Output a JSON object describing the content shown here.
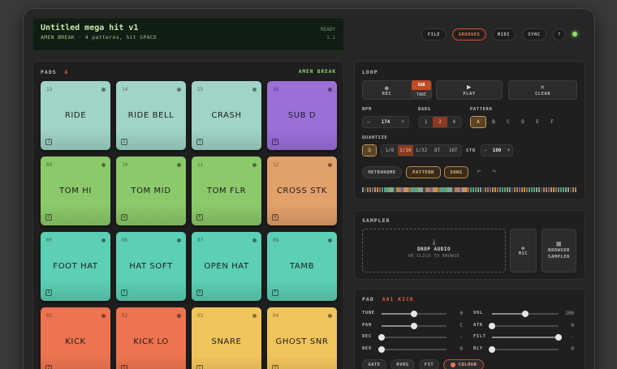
{
  "lcd": {
    "title": "Untitled mega hit v1",
    "subtitle": "AMEN BREAK · 4 patterns, hit SPACE",
    "status": "READY",
    "version": "1.1"
  },
  "topbar": {
    "file": "FILE",
    "grooves": "GROOVES",
    "midi": "MIDI",
    "sync": "SYNC",
    "help": "?"
  },
  "pads": {
    "label": "PADS",
    "bank": "A",
    "kit": "AMEN BREAK",
    "items": [
      {
        "num": "13",
        "name": "RIDE",
        "color": "#9fd4c6",
        "key": "1"
      },
      {
        "num": "14",
        "name": "RIDE BELL",
        "color": "#9fd4c6",
        "key": "2"
      },
      {
        "num": "15",
        "name": "CRASH",
        "color": "#9fd4c6",
        "key": "3"
      },
      {
        "num": "16",
        "name": "SUB D",
        "color": "#9a6fd8",
        "key": "4"
      },
      {
        "num": "09",
        "name": "TOM HI",
        "color": "#8cc96a",
        "key": "Q"
      },
      {
        "num": "10",
        "name": "TOM MID",
        "color": "#8cc96a",
        "key": "W"
      },
      {
        "num": "11",
        "name": "TOM FLR",
        "color": "#8cc96a",
        "key": "E"
      },
      {
        "num": "12",
        "name": "CROSS STK",
        "color": "#e2a06a",
        "key": "R"
      },
      {
        "num": "05",
        "name": "FOOT HAT",
        "color": "#5ccfb4",
        "key": "A"
      },
      {
        "num": "06",
        "name": "HAT SOFT",
        "color": "#5ccfb4",
        "key": "S"
      },
      {
        "num": "07",
        "name": "OPEN HAT",
        "color": "#5ccfb4",
        "key": "D"
      },
      {
        "num": "08",
        "name": "TAMB",
        "color": "#5ccfb4",
        "key": "F"
      },
      {
        "num": "01",
        "name": "KICK",
        "color": "#ec7450",
        "key": "Z"
      },
      {
        "num": "02",
        "name": "KICK LO",
        "color": "#ec7450",
        "key": "X"
      },
      {
        "num": "03",
        "name": "SNARE",
        "color": "#f0c45c",
        "key": "C"
      },
      {
        "num": "04",
        "name": "GHOST SNR",
        "color": "#f0c45c",
        "key": "V"
      }
    ]
  },
  "loop": {
    "label": "LOOP",
    "rec": "REC",
    "sub": "SUB",
    "take": "TAKE",
    "play": "PLAY",
    "clear": "CLEAR",
    "bpm_label": "BPM",
    "bpm": "174",
    "minus": "−",
    "plus": "+",
    "bars_label": "BARS",
    "bars": [
      "1",
      "2",
      "4"
    ],
    "pattern_label": "PATTERN",
    "patterns": [
      "A",
      "B",
      "C",
      "D",
      "E",
      "F"
    ],
    "quantize_label": "QUANTIZE",
    "q": "Q",
    "quant": [
      "1/8",
      "1/16",
      "1/32",
      "8T",
      "16T"
    ],
    "str_label": "STR",
    "str": "100",
    "metronome": "METRONOME",
    "pattern_btn": "PATTERN",
    "song_btn": "SONG",
    "undo": "↶",
    "redo": "↷"
  },
  "sampler": {
    "label": "SAMPLER",
    "drop": "DROP AUDIO",
    "drop_sub": "OR CLICK TO BROWSE",
    "mic": "MIC",
    "browse1": "BROWSER",
    "browse2": "SAMPLER"
  },
  "pad_edit": {
    "label": "PAD",
    "pad": "A01 KICK",
    "left": [
      {
        "name": "TUNE",
        "val": "0",
        "pos": 0.5
      },
      {
        "name": "PAN",
        "val": "C",
        "pos": 0.5
      },
      {
        "name": "DEC",
        "val": "-",
        "pos": 0.0
      },
      {
        "name": "REV",
        "val": "0",
        "pos": 0.0
      }
    ],
    "right": [
      {
        "name": "VOL",
        "val": "100",
        "pos": 0.5
      },
      {
        "name": "ATK",
        "val": "0",
        "pos": 0.0
      },
      {
        "name": "FILT",
        "val": "-",
        "pos": 1.0
      },
      {
        "name": "DLY",
        "val": "0",
        "pos": 0.0
      }
    ],
    "gate": "GATE",
    "rvrs": "RVRS",
    "fit": "FIT",
    "colour": "COLOUR"
  }
}
